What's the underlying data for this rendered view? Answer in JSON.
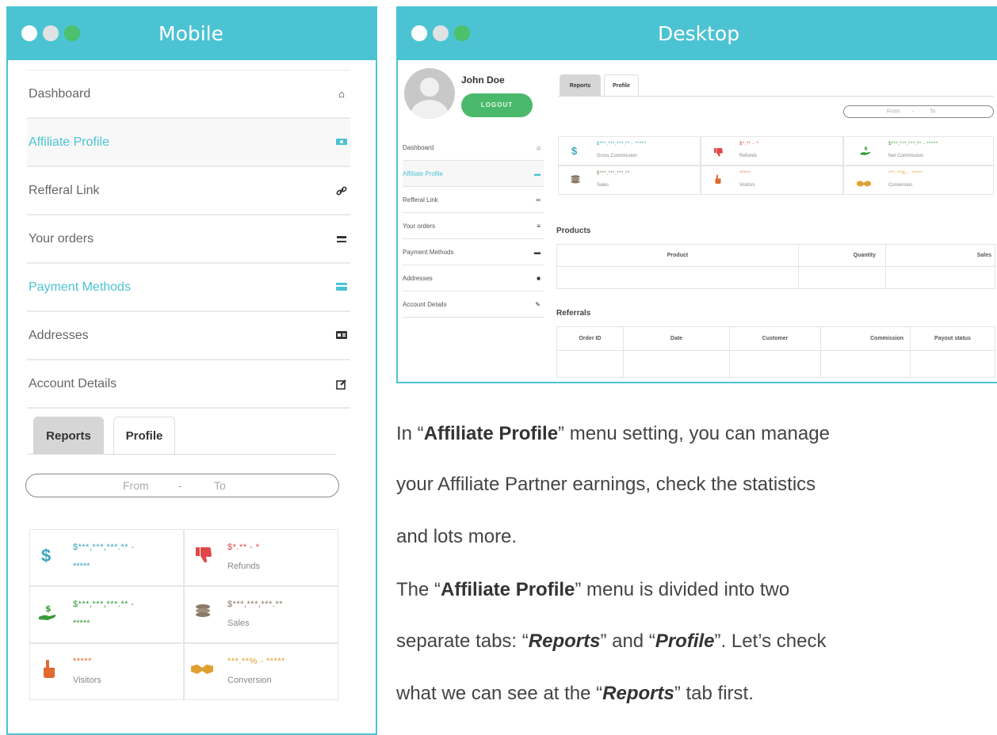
{
  "mobile": {
    "title": "Mobile",
    "nav": [
      {
        "label": "Dashboard",
        "icon": "home-icon"
      },
      {
        "label": "Affiliate Profile",
        "icon": "money-icon"
      },
      {
        "label": "Refferal Link",
        "icon": "link-icon"
      },
      {
        "label": "Your orders",
        "icon": "truck-icon"
      },
      {
        "label": "Payment Methods",
        "icon": "card-icon"
      },
      {
        "label": "Addresses",
        "icon": "address-card-icon"
      },
      {
        "label": "Account Details",
        "icon": "edit-icon"
      }
    ],
    "tabs": [
      "Reports",
      "Profile"
    ],
    "range": {
      "from": "From",
      "sep": "-",
      "to": "To"
    },
    "stats": [
      {
        "value": "$***,***,***.** -",
        "sub": "*****",
        "icon": "dollar-icon",
        "color": "#3aa6b9"
      },
      {
        "value": "$*.** - *",
        "sub": "Refunds",
        "icon": "thumbs-down-icon",
        "color": "#e04848"
      },
      {
        "value": "$***,***,***.** -",
        "sub": "*****",
        "icon": "hand-dollar-icon",
        "color": "#3a9a3a"
      },
      {
        "value": "$***,***,***.**",
        "sub": "Sales",
        "icon": "coins-icon",
        "color": "#8a7a66"
      },
      {
        "value": "*****",
        "sub": "Visitors",
        "icon": "pointer-icon",
        "color": "#e06a30"
      },
      {
        "value": "***.**% - *****",
        "sub": "Conversion",
        "icon": "handshake-icon",
        "color": "#e0a030"
      }
    ]
  },
  "desktop": {
    "title": "Desktop",
    "user": "John Doe",
    "logout": "LOGOUT",
    "nav": [
      "Dashboard",
      "Affiliate Profile",
      "Refferal Link",
      "Your orders",
      "Payment Methods",
      "Addresses",
      "Account Details"
    ],
    "tabs": [
      "Reports",
      "Profile"
    ],
    "range": {
      "from": "From",
      "sep": "-",
      "to": "To"
    },
    "stats": [
      {
        "value": "$***,***,***.** - *****",
        "sub": "Gross Commission"
      },
      {
        "value": "$*.** - *",
        "sub": "Refunds"
      },
      {
        "value": "$***,***,***.** - *****",
        "sub": "Net Commission"
      },
      {
        "value": "$***,***,***.**",
        "sub": "Sales"
      },
      {
        "value": "*****",
        "sub": "Visitors"
      },
      {
        "value": "***.**% - *****",
        "sub": "Conversion"
      }
    ],
    "products_title": "Products",
    "products_cols": [
      "Product",
      "Quantity",
      "Sales"
    ],
    "referrals_title": "Referrals",
    "referrals_cols": [
      "Order ID",
      "Date",
      "Customer",
      "Commission",
      "Payout status"
    ]
  },
  "text": {
    "p1a": "In “",
    "p1b": "Affiliate Profile",
    "p1c": "” menu setting, you can manage",
    "p2": "your Affiliate Partner earnings, check the statistics",
    "p3": "and lots more.",
    "p4a": "The “",
    "p4b": "Affiliate Profile",
    "p4c": "” menu is divided into two",
    "p5a": "separate tabs: “",
    "p5b": "Reports",
    "p5c": "” and “",
    "p5d": "Profile",
    "p5e": "”. Let’s check",
    "p6a": "what we can see at the “",
    "p6b": "Reports",
    "p6c": "” tab first."
  }
}
